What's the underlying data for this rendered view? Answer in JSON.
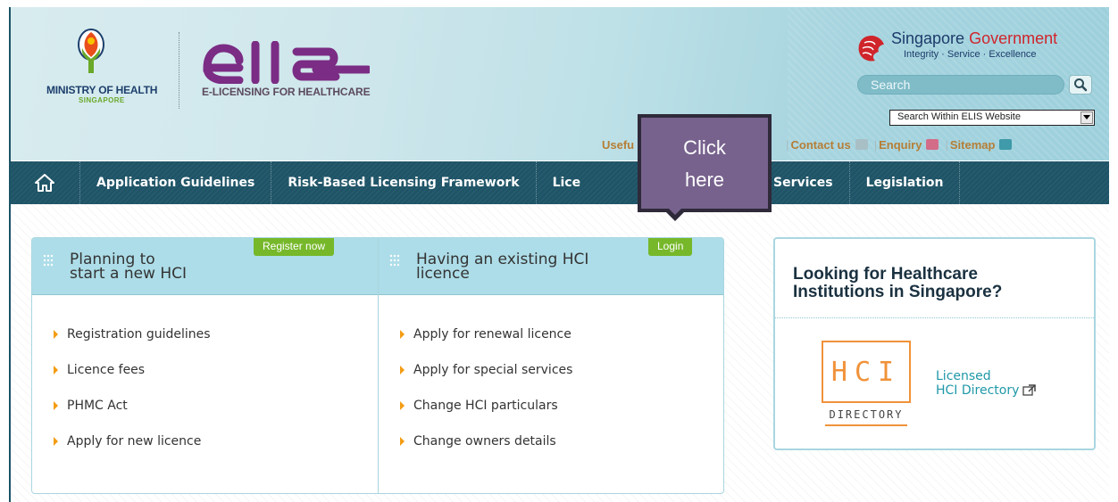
{
  "header": {
    "moh_title": "MINISTRY OF HEALTH",
    "moh_subtitle": "SINGAPORE",
    "elis_subtitle": "E-LICENSING FOR HEALTHCARE",
    "gov_title_part1": "Singapore",
    "gov_title_part2": "Government",
    "gov_motto": "Integrity · Service · Excellence",
    "search_placeholder": "Search",
    "search_scope": "Search Within ELIS Website",
    "util_links": {
      "useful": "Usefu",
      "contact": "Contact us",
      "enquiry": "Enquiry",
      "sitemap": "Sitemap"
    }
  },
  "nav": {
    "home_icon": "home-icon",
    "items": [
      {
        "label": "Application Guidelines"
      },
      {
        "label": "Risk-Based Licensing Framework"
      },
      {
        "label": "Lice"
      },
      {
        "label": "mbulance Services"
      },
      {
        "label": "Legislation"
      }
    ]
  },
  "tooltip": {
    "line1": "Click",
    "line2": "here"
  },
  "panel_left": {
    "title": "Planning to\nstart a new HCI",
    "button": "Register now",
    "links": [
      "Registration guidelines",
      "Licence fees",
      "PHMC Act",
      "Apply for new licence"
    ]
  },
  "panel_right": {
    "title": "Having an existing HCI\nlicence",
    "button": "Login",
    "links": [
      "Apply for renewal licence",
      "Apply for special services",
      "Change HCI particulars",
      "Change owners details"
    ]
  },
  "side_panel": {
    "title": "Looking for Healthcare\nInstitutions in Singapore?",
    "logo_text": "HCI",
    "logo_subtext": "DIRECTORY",
    "link": "Licensed\nHCI Directory"
  },
  "colors": {
    "nav_bg": "#1f5467",
    "accent_green": "#76b82a",
    "bullet_orange": "#f39c12",
    "tooltip_bg": "#77628d",
    "link_teal": "#1f98a8"
  }
}
